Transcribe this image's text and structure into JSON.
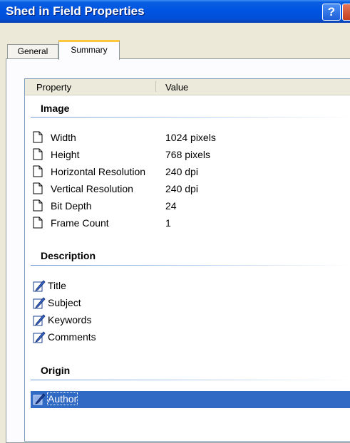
{
  "window": {
    "title": "Shed in Field Properties"
  },
  "tabs": [
    {
      "label": "General",
      "active": false
    },
    {
      "label": "Summary",
      "active": true
    }
  ],
  "columns": {
    "property": "Property",
    "value": "Value"
  },
  "groups": {
    "image": {
      "title": "Image",
      "rows": [
        {
          "name": "Width",
          "value": "1024 pixels",
          "icon": "document-icon"
        },
        {
          "name": "Height",
          "value": "768 pixels",
          "icon": "document-icon"
        },
        {
          "name": "Horizontal Resolution",
          "value": "240 dpi",
          "icon": "document-icon"
        },
        {
          "name": "Vertical Resolution",
          "value": "240 dpi",
          "icon": "document-icon"
        },
        {
          "name": "Bit Depth",
          "value": "24",
          "icon": "document-icon"
        },
        {
          "name": "Frame Count",
          "value": "1",
          "icon": "document-icon"
        }
      ]
    },
    "description": {
      "title": "Description",
      "rows": [
        {
          "name": "Title",
          "value": "",
          "icon": "edit-icon"
        },
        {
          "name": "Subject",
          "value": "",
          "icon": "edit-icon"
        },
        {
          "name": "Keywords",
          "value": "",
          "icon": "edit-icon"
        },
        {
          "name": "Comments",
          "value": "",
          "icon": "edit-icon"
        }
      ]
    },
    "origin": {
      "title": "Origin",
      "rows": [
        {
          "name": "Author",
          "value": "",
          "icon": "edit-icon",
          "selected": true
        }
      ]
    }
  },
  "colors": {
    "titlebar": "#0054e3",
    "selection": "#316ac5",
    "tab_highlight": "#ffc83c"
  }
}
